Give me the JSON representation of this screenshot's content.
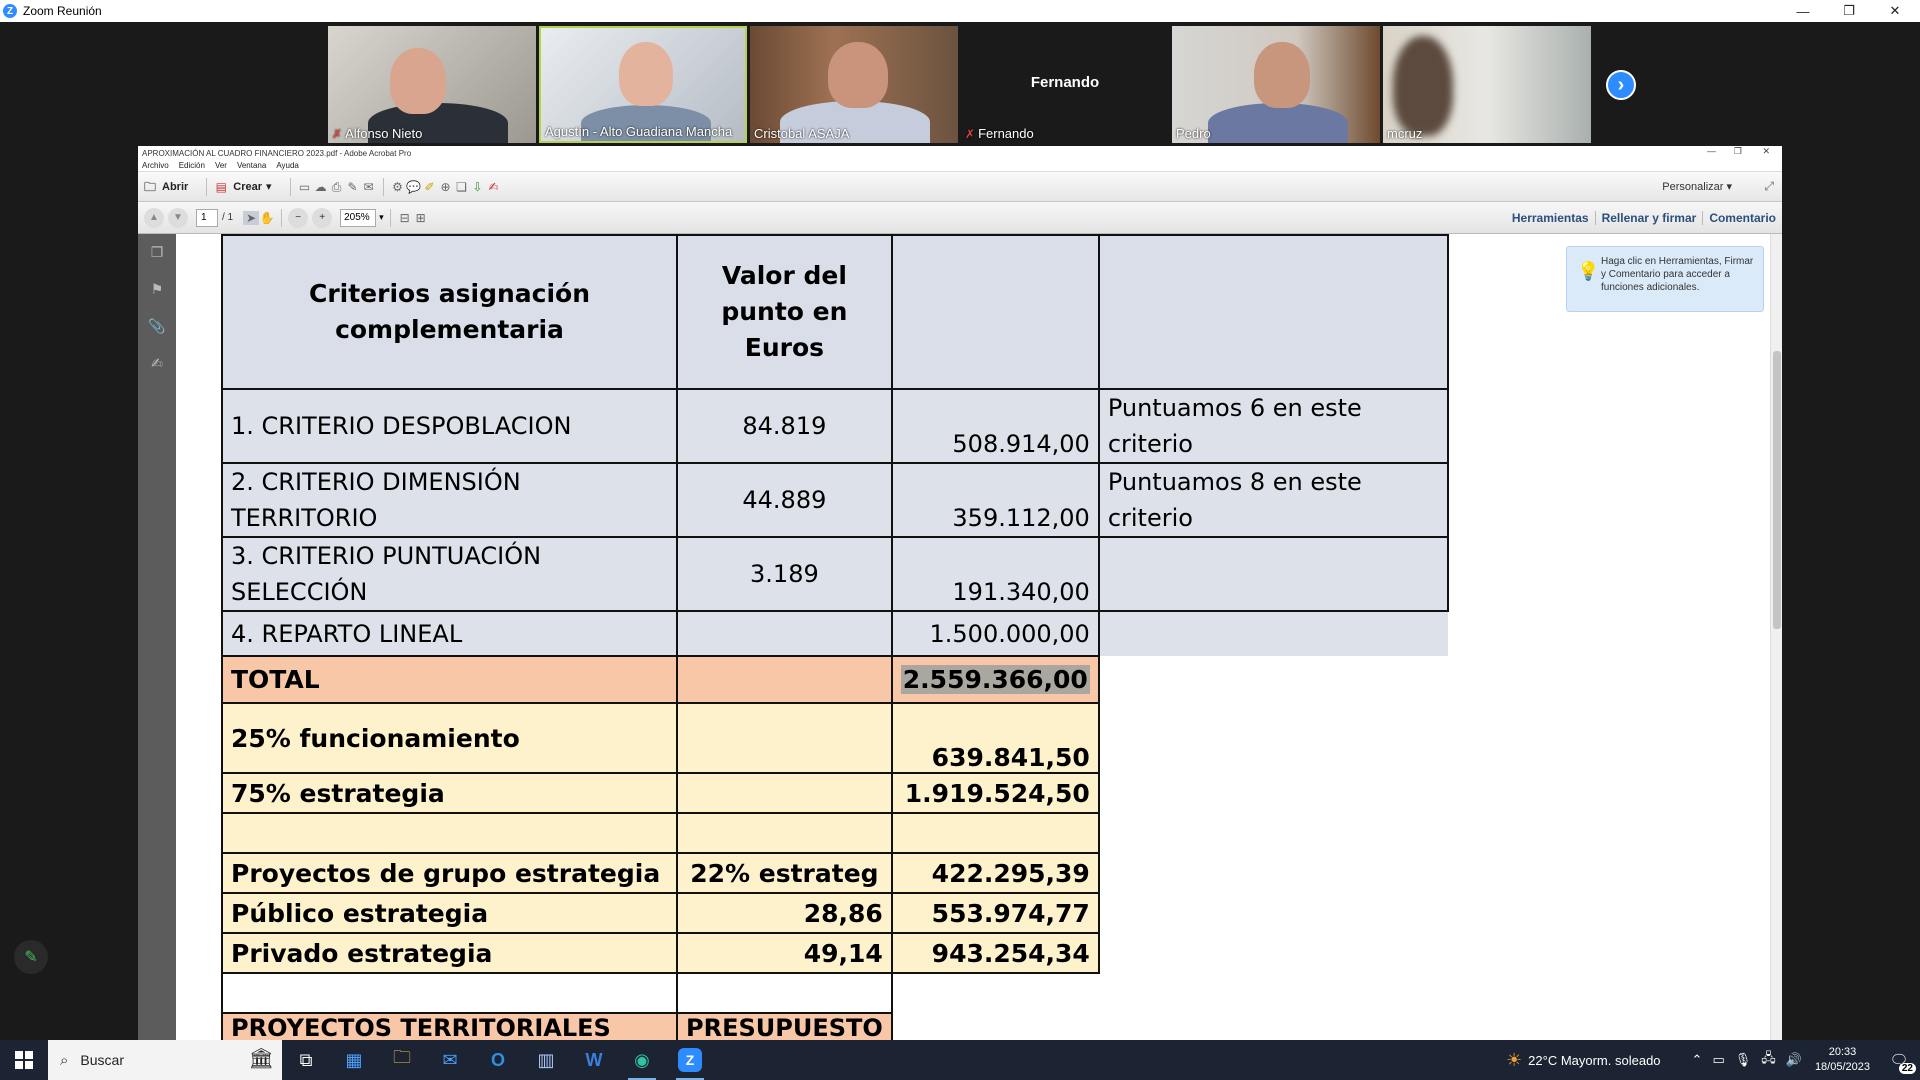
{
  "zoom": {
    "window_title": "Zoom Reunión",
    "participants": [
      {
        "name": "Alfonso Nieto",
        "muted": true
      },
      {
        "name": "Agustín - Alto Guadiana Mancha",
        "muted": false
      },
      {
        "name": "Cristobal ASAJA",
        "muted": false
      },
      {
        "name": "Fernando",
        "muted": true,
        "center_name": "Fernando"
      },
      {
        "name": "Pedro",
        "muted": false
      },
      {
        "name": "mcruz",
        "muted": false
      }
    ]
  },
  "acrobat": {
    "title": "APROXIMACIÓN AL CUADRO FINANCIERO 2023.pdf - Adobe Acrobat Pro",
    "menu": [
      "Archivo",
      "Edición",
      "Ver",
      "Ventana",
      "Ayuda"
    ],
    "toolbar": {
      "open_label": "Abrir",
      "create_label": "Crear",
      "customize_label": "Personalizar"
    },
    "nav": {
      "page_value": "1",
      "page_total": "/ 1",
      "zoom_value": "205%"
    },
    "tabs": [
      "Herramientas",
      "Rellenar y firmar",
      "Comentario"
    ],
    "hint": "Haga clic en Herramientas, Firmar y Comentario para acceder a funciones adicionales."
  },
  "sheet": {
    "header": {
      "col1": "Criterios asignación complementaria",
      "col2": "Valor del punto en Euros",
      "col3": "",
      "col4": ""
    },
    "criteria": [
      {
        "label": "1. CRITERIO DESPOBLACION",
        "point": "84.819",
        "amount": "508.914,00",
        "note": "Puntuamos 6 en este criterio"
      },
      {
        "label": "2. CRITERIO DIMENSIÓN TERRITORIO",
        "point": "44.889",
        "amount": "359.112,00",
        "note": "Puntuamos 8 en este criterio"
      },
      {
        "label": "3. CRITERIO PUNTUACIÓN SELECCIÓN",
        "point": "3.189",
        "amount": "191.340,00",
        "note": ""
      }
    ],
    "lineal": {
      "label": "4. REPARTO LINEAL",
      "amount": "1.500.000,00"
    },
    "total": {
      "label": "TOTAL",
      "amount": "2.559.366,00"
    },
    "funcionamiento": {
      "label": "25% funcionamiento",
      "amount": "639.841,50"
    },
    "estrategia": {
      "label": "75% estrategia",
      "amount": "1.919.524,50"
    },
    "grupo": {
      "label": "Proyectos de grupo estrategia",
      "pct": "22% estrateg",
      "amount": "422.295,39"
    },
    "publico": {
      "label": "Público estrategia",
      "pct": "28,86",
      "amount": "553.974,77"
    },
    "privado": {
      "label": "Privado estrategia",
      "pct": "49,14",
      "amount": "943.254,34"
    },
    "territoriales": {
      "label": "PROYECTOS TERRITORIALES",
      "budget": "PRESUPUESTO"
    }
  },
  "taskbar": {
    "search_placeholder": "Buscar",
    "weather": "22°C  Mayorm. soleado",
    "time": "20:33",
    "date": "18/05/2023",
    "notifications": "22"
  }
}
